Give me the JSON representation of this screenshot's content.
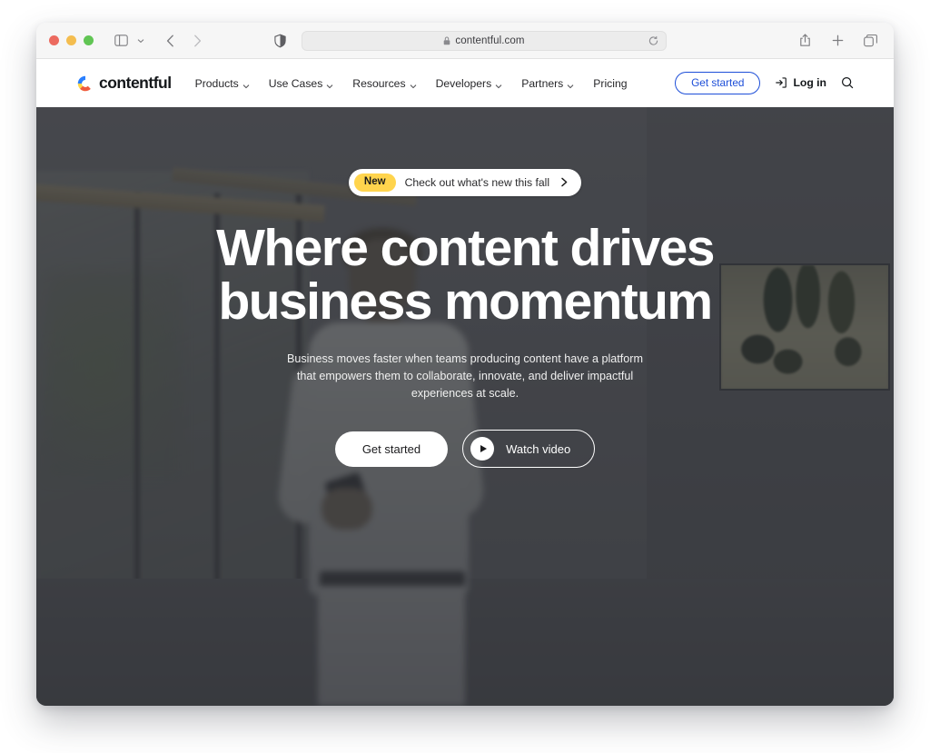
{
  "browser": {
    "traffic_lights": [
      "close",
      "minimize",
      "maximize"
    ],
    "sidebar_toggle_icon": "sidebar-icon",
    "tab_overview_icon": "chevron-down-icon",
    "back_icon": "chevron-left-icon",
    "forward_icon": "chevron-right-icon",
    "shield_icon": "privacy-shield-icon",
    "url": "contentful.com",
    "lock_icon": "lock-icon",
    "reload_icon": "reload-icon",
    "share_icon": "share-icon",
    "new_tab_icon": "plus-icon",
    "tabs_icon": "tabs-icon"
  },
  "site_header": {
    "brand": {
      "name": "contentful",
      "mark_icon": "contentful-logo-icon",
      "colors": {
        "blue": "#2a7fff",
        "yellow": "#ffd74b",
        "orange": "#ef5b3f",
        "red": "#e34c3a"
      }
    },
    "nav": [
      {
        "label": "Products",
        "has_dropdown": true
      },
      {
        "label": "Use Cases",
        "has_dropdown": true
      },
      {
        "label": "Resources",
        "has_dropdown": true
      },
      {
        "label": "Developers",
        "has_dropdown": true
      },
      {
        "label": "Partners",
        "has_dropdown": true
      },
      {
        "label": "Pricing",
        "has_dropdown": false
      }
    ],
    "get_started_label": "Get started",
    "get_started_color": "#1d4ed8",
    "login_label": "Log in",
    "login_icon": "login-arrow-icon",
    "search_icon": "search-icon"
  },
  "hero": {
    "announcement": {
      "badge": "New",
      "badge_color": "#ffd44d",
      "text": "Check out what's new this fall",
      "arrow_icon": "chevron-right-icon"
    },
    "title_line1": "Where content drives",
    "title_line2": "business momentum",
    "subtitle": "Business moves faster when teams producing content have a platform that empowers them to collaborate, innovate, and deliver impactful experiences at scale.",
    "cta_primary": "Get started",
    "cta_secondary": "Watch video",
    "cta_secondary_icon": "play-icon",
    "background": {
      "scene": "office-interior-photo",
      "scrim_color": "#2a2c30"
    }
  }
}
